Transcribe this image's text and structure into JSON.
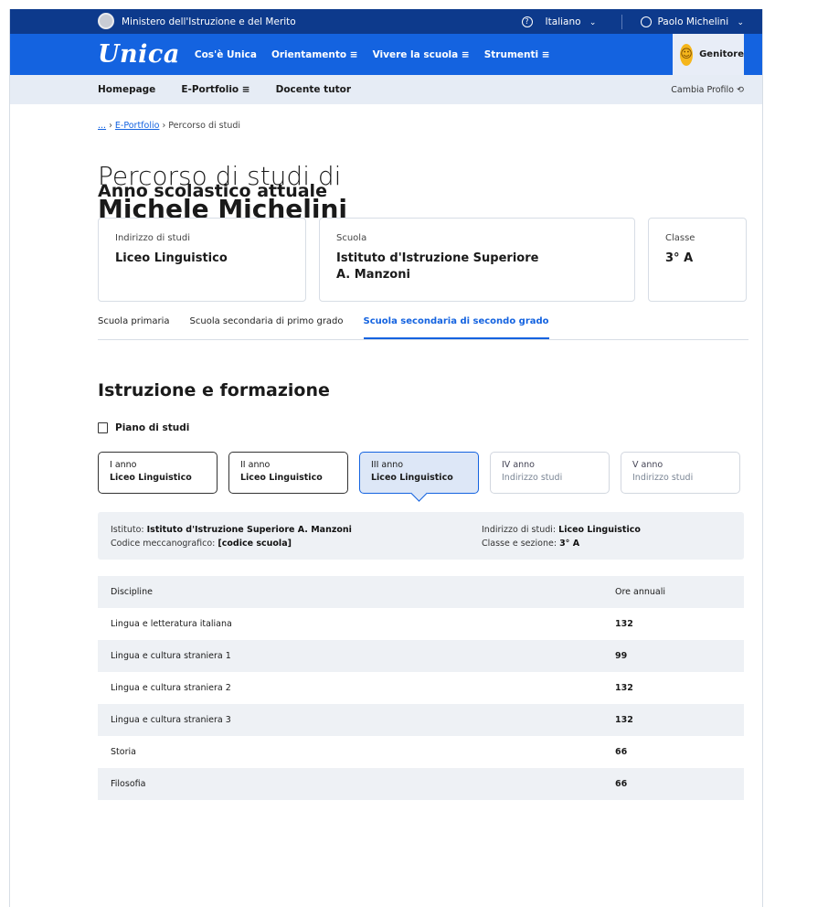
{
  "topbar": {
    "ministry": "Ministero dell'Istruzione e del Merito",
    "help_icon": "?",
    "language": "Italiano",
    "user": "Paolo Michelini"
  },
  "navbar": {
    "logo": "Unica",
    "items": [
      "Cos'è Unica",
      "Orientamento ≡",
      "Vivere la scuola ≡",
      "Strumenti ≡"
    ],
    "profile_role": "Genitore"
  },
  "subnav": {
    "items": [
      "Homepage",
      "E-Portfolio ≡",
      "Docente tutor"
    ],
    "change_profile": "Cambia Profilo"
  },
  "breadcrumb": {
    "ellipsis": "...",
    "parent": "E-Portfolio",
    "current": "Percorso di studi"
  },
  "page": {
    "title_line1": "Percorso di studi di",
    "title_line2": "Michele Michelini"
  },
  "current_year": {
    "heading": "Anno scolastico attuale",
    "cards": [
      {
        "label": "Indirizzo di studi",
        "value": "Liceo Linguistico"
      },
      {
        "label": "Scuola",
        "value": "Istituto d'Istruzione Superiore A. Manzoni"
      },
      {
        "label": "Classe",
        "value": "3° A"
      }
    ]
  },
  "tabs": [
    "Scuola primaria",
    "Scuola secondaria di primo grado",
    "Scuola secondaria di secondo grado"
  ],
  "education": {
    "heading": "Istruzione e formazione",
    "plan_label": "Piano di studi",
    "years": [
      {
        "year": "I anno",
        "sub": "Liceo Linguistico"
      },
      {
        "year": "II anno",
        "sub": "Liceo Linguistico"
      },
      {
        "year": "III anno",
        "sub": "Liceo Linguistico"
      },
      {
        "year": "IV anno",
        "sub": "Indirizzo studi"
      },
      {
        "year": "V anno",
        "sub": "Indirizzo studi"
      }
    ],
    "info": {
      "institute_label": "Istituto:",
      "institute_value": "Istituto d'Istruzione Superiore A. Manzoni",
      "code_label": "Codice meccanografico:",
      "code_value": "[codice scuola]",
      "address_label": "Indirizzo di studi:",
      "address_value": "Liceo Linguistico",
      "class_label": "Classe e sezione:",
      "class_value": "3° A"
    }
  },
  "table": {
    "headers": {
      "discipline": "Discipline",
      "hours": "Ore annuali"
    },
    "rows": [
      {
        "discipline": "Lingua e letteratura italiana",
        "hours": "132"
      },
      {
        "discipline": "Lingua e cultura straniera 1",
        "hours": "99"
      },
      {
        "discipline": "Lingua e cultura straniera 2",
        "hours": "132"
      },
      {
        "discipline": "Lingua e cultura straniera 3",
        "hours": "132"
      },
      {
        "discipline": "Storia",
        "hours": "66"
      },
      {
        "discipline": "Filosofia",
        "hours": "66"
      }
    ]
  }
}
